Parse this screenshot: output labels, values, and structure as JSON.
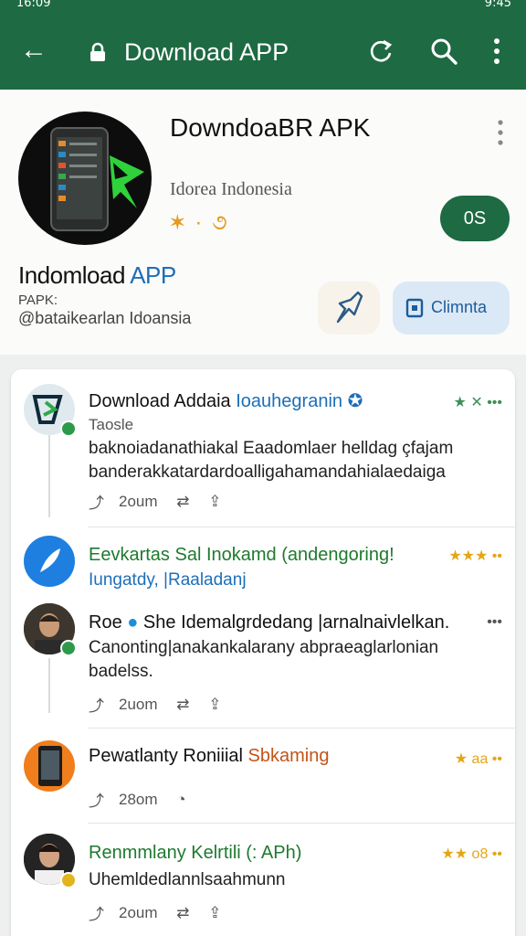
{
  "status_bar": {
    "time": "16:09",
    "right": "9:45"
  },
  "app_bar": {
    "title": "Download APP"
  },
  "header": {
    "app_name": "DowndoaBR APK",
    "app_sub": "Idorea Indonesia",
    "rating_glyphs": "✶ · ૭",
    "os_button": "0S",
    "dev_name_plain": "Indomload ",
    "dev_name_accent": "APP",
    "dev_line1": "PAPK:",
    "dev_line2": "@bataikearlan Idoansia",
    "save_button": "Climnta"
  },
  "feed": {
    "posts": [
      {
        "title": "Download Addaia",
        "tag": "Ioauhegranin",
        "stars": "★ ✕ •••",
        "sub": "Taosle",
        "line1": "baknoiadanathiakal Eaadomlaer helldag çfajam",
        "line2": "banderakkatardardoalligahamandahialaedaiga",
        "time": "2oum"
      },
      {
        "title": "Eevkartas Sal Inokamd (andengoring!",
        "stars": "★★★ ••",
        "line1": "Iungatdy, |Raaladanj"
      },
      {
        "title": "Roe",
        "title_rest": "She Idemalgrdedang |arnalnaivlelkan.",
        "stars": "•••",
        "line1": "Canonting|anakankalarany abpraeaglarlonian",
        "line2": "badelss.",
        "time": "2uom"
      },
      {
        "title": "Pewatlanty Roniiial",
        "tag": "Sbkaming",
        "stars": "★ aa ••",
        "time": "28om"
      },
      {
        "title": "Renmmlany Kelrtili (: APh)",
        "stars": "★★ o8 ••",
        "line1": "Uhemldedlannlsaahmunn",
        "time": "2oum"
      }
    ]
  },
  "colors": {
    "brand_green": "#1e6a43",
    "accent_blue": "#1d6fb8",
    "star_gold": "#e5a614"
  }
}
